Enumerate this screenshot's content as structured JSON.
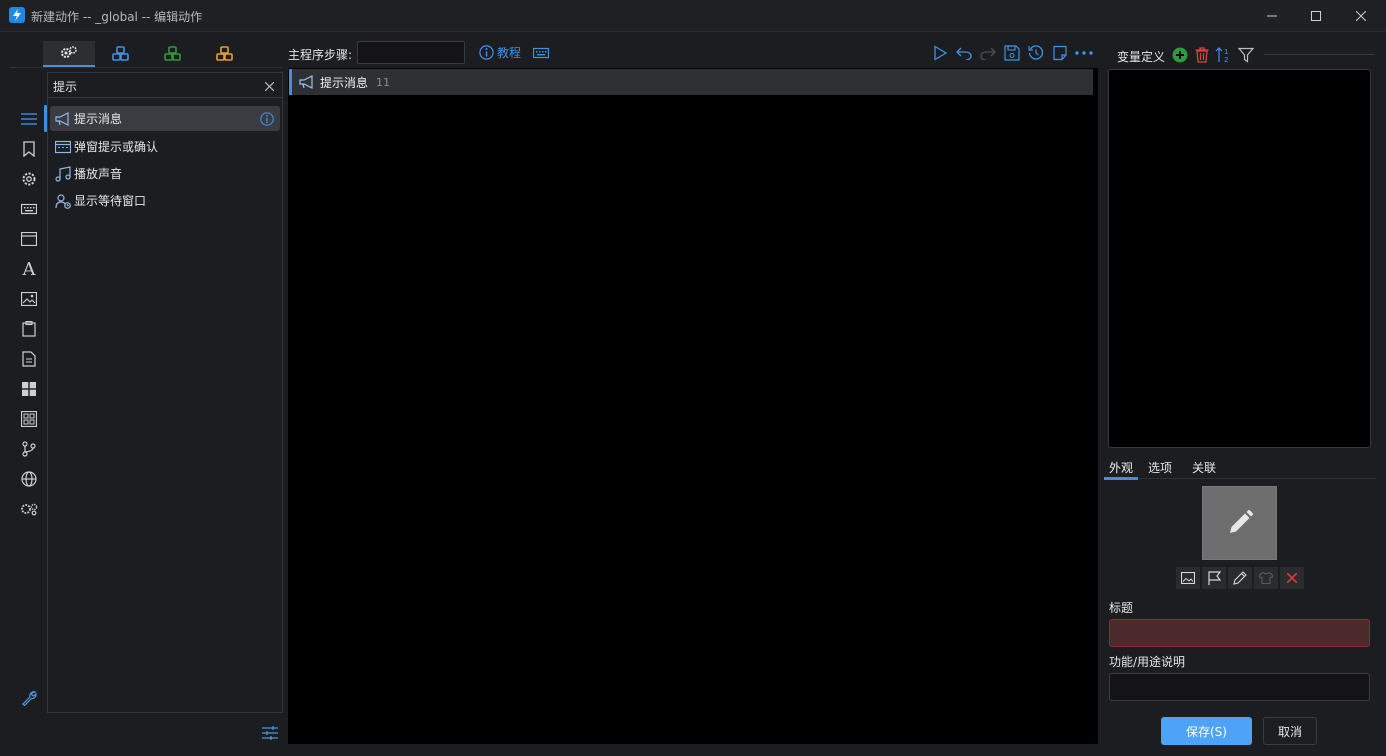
{
  "window": {
    "title": "新建动作 -- _global -- 编辑动作",
    "controls": [
      "minimize-icon",
      "maximize-icon",
      "close-icon"
    ]
  },
  "left_tabs": [
    {
      "icon": "gears-icon",
      "color": "#e6e6e6",
      "active": true
    },
    {
      "icon": "cubes-icon",
      "color": "#3c94e8"
    },
    {
      "icon": "cubes-icon",
      "color": "#2e9a3c"
    },
    {
      "icon": "cubes-icon",
      "color": "#e8a02a"
    }
  ],
  "side_icons": [
    "list-icon",
    "bookmark-icon",
    "gear-icon",
    "keyboard-icon",
    "window-icon",
    "font-icon",
    "image-icon",
    "clipboard-icon",
    "document-icon",
    "windows-logo-icon",
    "grid-icon",
    "branch-icon",
    "globe-icon",
    "cogs-icon",
    "wrench-icon"
  ],
  "search": {
    "value": "提示",
    "placeholder": ""
  },
  "action_list": [
    {
      "label": "提示消息",
      "icon": "megaphone-icon",
      "selected": true
    },
    {
      "label": "弹窗提示或确认",
      "icon": "dialog-icon"
    },
    {
      "label": "播放声音",
      "icon": "music-icon"
    },
    {
      "label": "显示等待窗口",
      "icon": "user-wait-icon"
    }
  ],
  "main": {
    "steps_label": "主程序步骤:",
    "steps_value": "",
    "tutorial_label": "教程",
    "toolbar_icons": [
      "play-icon",
      "undo-icon",
      "redo-icon",
      "save-icon",
      "history-icon",
      "note-icon",
      "more-icon"
    ],
    "steps": [
      {
        "label": "提示消息",
        "number": "11",
        "icon": "megaphone-icon"
      }
    ]
  },
  "variables": {
    "title": "变量定义",
    "icons": [
      "add-icon",
      "delete-icon",
      "sort-icon",
      "filter-icon"
    ]
  },
  "props": {
    "tabs": [
      "外观",
      "选项",
      "关联"
    ],
    "active_tab": "外观",
    "icon_tools": [
      "image-icon",
      "flag-icon",
      "pen-icon",
      "shirt-icon",
      "remove-icon"
    ],
    "title_label": "标题",
    "title_value": "",
    "desc_label": "功能/用途说明",
    "desc_value": "",
    "save_label": "保存(S)",
    "cancel_label": "取消"
  },
  "colors": {
    "accent": "#3f8fe3",
    "save_button": "#4da3f7",
    "error_field": "#8b2d2f"
  }
}
